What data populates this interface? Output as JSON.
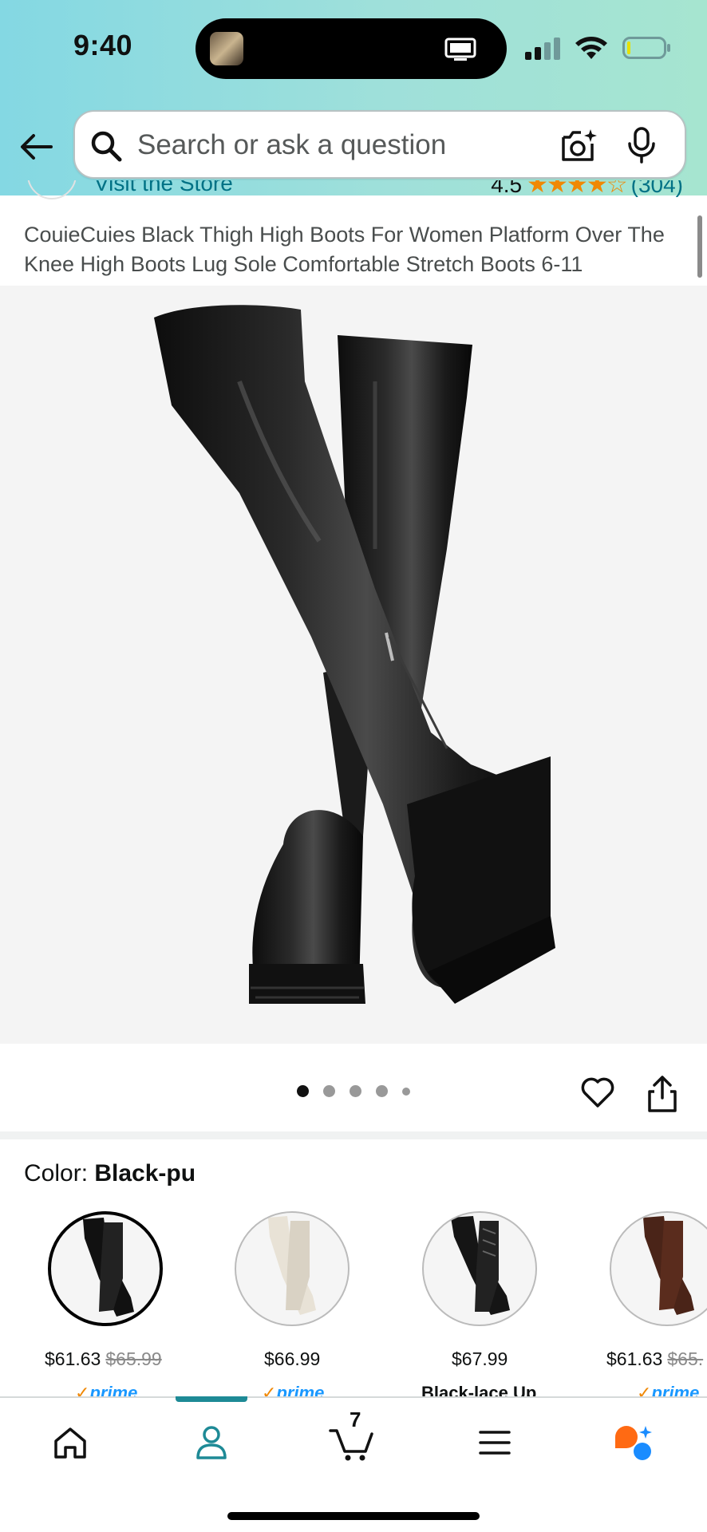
{
  "status_bar": {
    "time": "9:40"
  },
  "search": {
    "placeholder": "Search or ask a question"
  },
  "store": {
    "link_text": "Visit the Store",
    "rating": "4.5",
    "stars": "★★★★☆",
    "review_count": "(304)"
  },
  "product": {
    "title": "CouieCuies Black Thigh High Boots For Women Platform Over The Knee High Boots Lug Sole Comfortable Stretch Boots 6-11"
  },
  "gallery": {
    "total_dots": 5,
    "active_index": 0
  },
  "color": {
    "label": "Color: ",
    "selected": "Black-pu"
  },
  "variants": [
    {
      "price": "$61.63",
      "list_price": "$65.99",
      "badge": "prime"
    },
    {
      "price": "$66.99",
      "list_price": "",
      "badge": "prime"
    },
    {
      "price": "$67.99",
      "list_price": "",
      "name": "Black-lace Up"
    },
    {
      "price": "$61.63",
      "list_price": "$65.",
      "badge": "prime"
    }
  ],
  "cart": {
    "count": "7"
  },
  "colors": {
    "header_gradient_start": "#84d8e3",
    "header_gradient_end": "#a6e5d0",
    "link": "#007185",
    "star": "#f08804",
    "prime": "#1a98ff",
    "nav_active": "#1e8a96"
  }
}
